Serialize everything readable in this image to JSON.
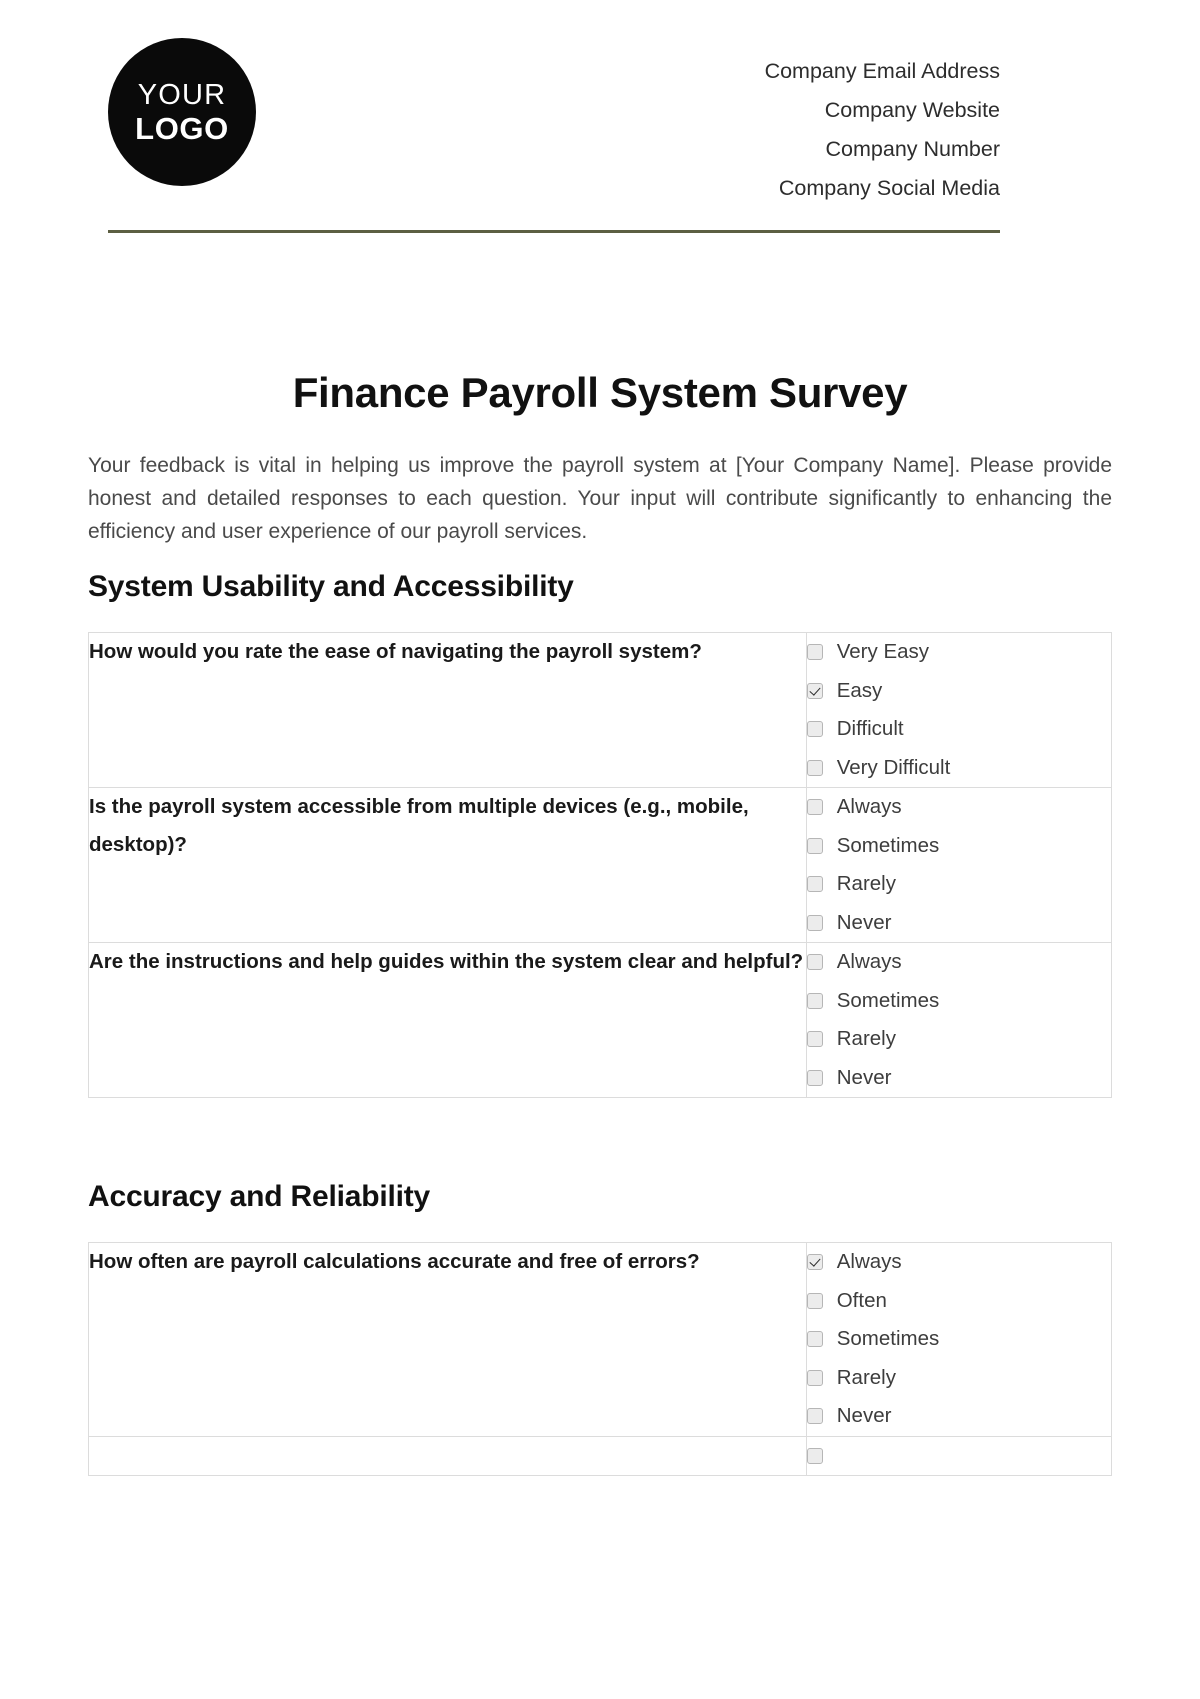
{
  "header": {
    "logo": {
      "line1": "YOUR",
      "line2": "LOGO"
    },
    "contact": [
      "Company Email Address",
      "Company Website",
      "Company Number",
      "Company Social Media"
    ],
    "divider_color": "#5c5f42"
  },
  "document": {
    "title": "Finance Payroll System Survey",
    "intro": "Your feedback is vital in helping us improve the payroll system at [Your Company Name]. Please provide honest and detailed responses to each question. Your input will contribute significantly to enhancing the efficiency and user experience of our payroll services."
  },
  "sections": [
    {
      "heading": "System Usability and Accessibility",
      "rows": [
        {
          "question": "How would you rate the ease of navigating the payroll system?",
          "options": [
            {
              "label": "Very Easy",
              "checked": false
            },
            {
              "label": "Easy",
              "checked": true
            },
            {
              "label": "Difficult",
              "checked": false
            },
            {
              "label": "Very Difficult",
              "checked": false
            }
          ]
        },
        {
          "question": "Is the payroll system accessible from multiple devices (e.g., mobile, desktop)?",
          "options": [
            {
              "label": "Always",
              "checked": false
            },
            {
              "label": "Sometimes",
              "checked": false
            },
            {
              "label": "Rarely",
              "checked": false
            },
            {
              "label": "Never",
              "checked": false
            }
          ]
        },
        {
          "question": "Are the instructions and help guides within the system clear and helpful?",
          "options": [
            {
              "label": "Always",
              "checked": false
            },
            {
              "label": "Sometimes",
              "checked": false
            },
            {
              "label": "Rarely",
              "checked": false
            },
            {
              "label": "Never",
              "checked": false
            }
          ]
        }
      ]
    },
    {
      "heading": "Accuracy and Reliability",
      "rows": [
        {
          "question": "How often are payroll calculations accurate and free of errors?",
          "options": [
            {
              "label": "Always",
              "checked": true
            },
            {
              "label": "Often",
              "checked": false
            },
            {
              "label": "Sometimes",
              "checked": false
            },
            {
              "label": "Rarely",
              "checked": false
            },
            {
              "label": "Never",
              "checked": false
            }
          ]
        },
        {
          "question": "",
          "options": [
            {
              "label": "",
              "checked": false
            }
          ]
        }
      ]
    }
  ]
}
